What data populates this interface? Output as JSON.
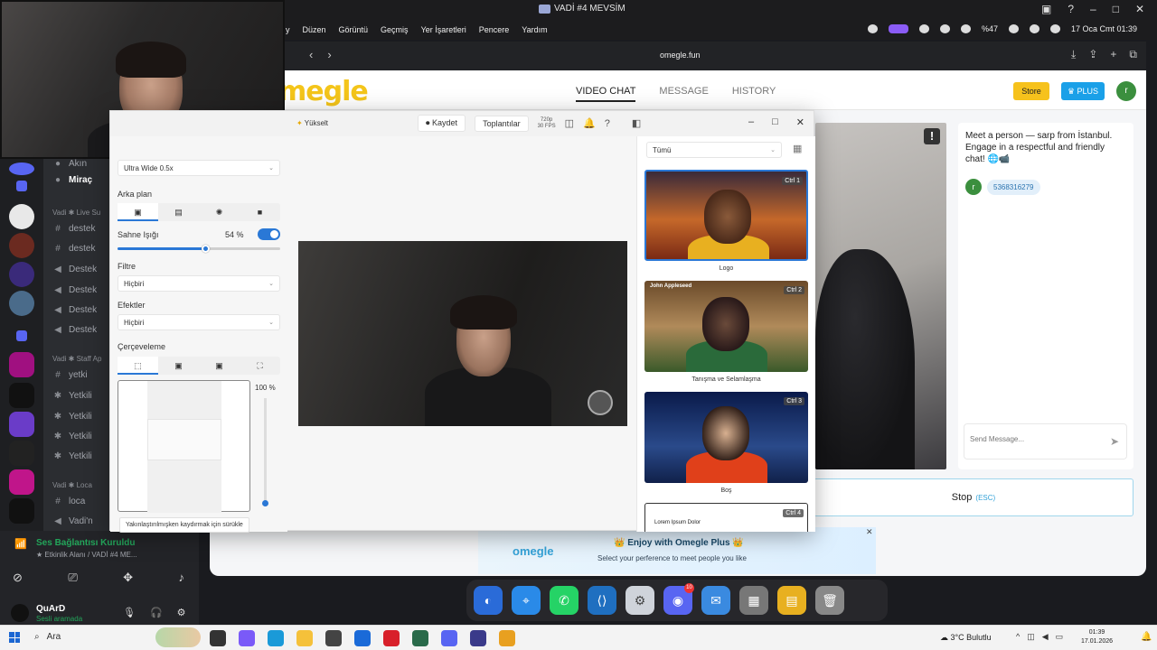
{
  "mac": {
    "window_title": "VADİ #4 MEVSİM",
    "menu": [
      "y",
      "Düzen",
      "Görüntü",
      "Geçmiş",
      "Yer İşaretleri",
      "Pencere",
      "Yardım"
    ],
    "battery": "%47",
    "datetime": "17 Oca Cmt  01:39"
  },
  "browser": {
    "url": "omegle.fun"
  },
  "omegle": {
    "logo": "megle",
    "nav": [
      "VIDEO CHAT",
      "MESSAGE",
      "HISTORY"
    ],
    "store": "Store",
    "plus": "♛ PLUS",
    "avatar_initial": "r",
    "chat_intro": "Meet a person — sarp from İstanbul. Engage in a respectful and friendly chat! 🌐📹",
    "chat_user_initial": "r",
    "chat_bubble": "5368316279",
    "send_placeholder": "Send Message...",
    "stop_label": "Stop",
    "stop_hint": "(ESC)",
    "ad_logo": "omegle",
    "ad_title": "👑 Enjoy with Omegle Plus 👑",
    "ad_sub": "Select your perference to meet people you like"
  },
  "discord": {
    "channels": [
      {
        "sym": "",
        "name": "Akın"
      },
      {
        "sym": "",
        "name": "Miraç"
      },
      {
        "sym": "cat",
        "name": "Vadi ✱ Live Su"
      },
      {
        "sym": "#",
        "name": "destek"
      },
      {
        "sym": "#",
        "name": "destek"
      },
      {
        "sym": "🔊",
        "name": "Destek"
      },
      {
        "sym": "🔊",
        "name": "Destek"
      },
      {
        "sym": "🔊",
        "name": "Destek"
      },
      {
        "sym": "🔊",
        "name": "Destek"
      },
      {
        "sym": "cat",
        "name": "Vadi ✱ Staff Ap"
      },
      {
        "sym": "#",
        "name": "yetki"
      },
      {
        "sym": "🔊",
        "name": "Yetkili"
      },
      {
        "sym": "🔊",
        "name": "Yetkili"
      },
      {
        "sym": "🔊",
        "name": "Yetkili"
      },
      {
        "sym": "🔊",
        "name": "Yetkili"
      },
      {
        "sym": "cat",
        "name": "Vadi ✱ Loca"
      },
      {
        "sym": "#",
        "name": "loca"
      },
      {
        "sym": "🔊",
        "name": "Vadi'n"
      }
    ],
    "voice_status": "Ses Bağlantısı Kuruldu",
    "voice_sub": "★ Etkinlik Alanı / VADİ #4 ME...",
    "user_name": "QuArD",
    "user_status": "Sesli aramada"
  },
  "camera_app": {
    "upgrade": "Yükselt",
    "record": "Kaydet",
    "meetings": "Toplantılar",
    "resolution": "720p\n30 FPS",
    "lens": "Ultra Wide 0.5x",
    "background_label": "Arka plan",
    "stage_light_label": "Sahne Işığı",
    "stage_light_value": "54 %",
    "stage_light_pct": 54,
    "filter_label": "Filtre",
    "filter_value": "Hiçbiri",
    "effects_label": "Efektler",
    "effects_value": "Hiçbiri",
    "framing_label": "Çerçeveleme",
    "zoom_value": "100 %",
    "zoom_tip": "Yakınlaştırılmışken kaydırmak için sürükle",
    "bg_filter": "Tümü",
    "backgrounds": [
      {
        "label": "Logo",
        "ctrl": "Ctrl 1"
      },
      {
        "label": "Tanışma ve Selamlaşma",
        "ctrl": "Ctrl 2",
        "card_title": "John Appleseed"
      },
      {
        "label": "Boş",
        "ctrl": "Ctrl 3"
      },
      {
        "label": "",
        "ctrl": "Ctrl 4",
        "card_title": "Lorem Ipsum Dolor"
      }
    ]
  },
  "taskbar": {
    "search": "Ara",
    "weather": "3°C Bulutlu",
    "time": "01:39",
    "date": "17.01.2026"
  }
}
